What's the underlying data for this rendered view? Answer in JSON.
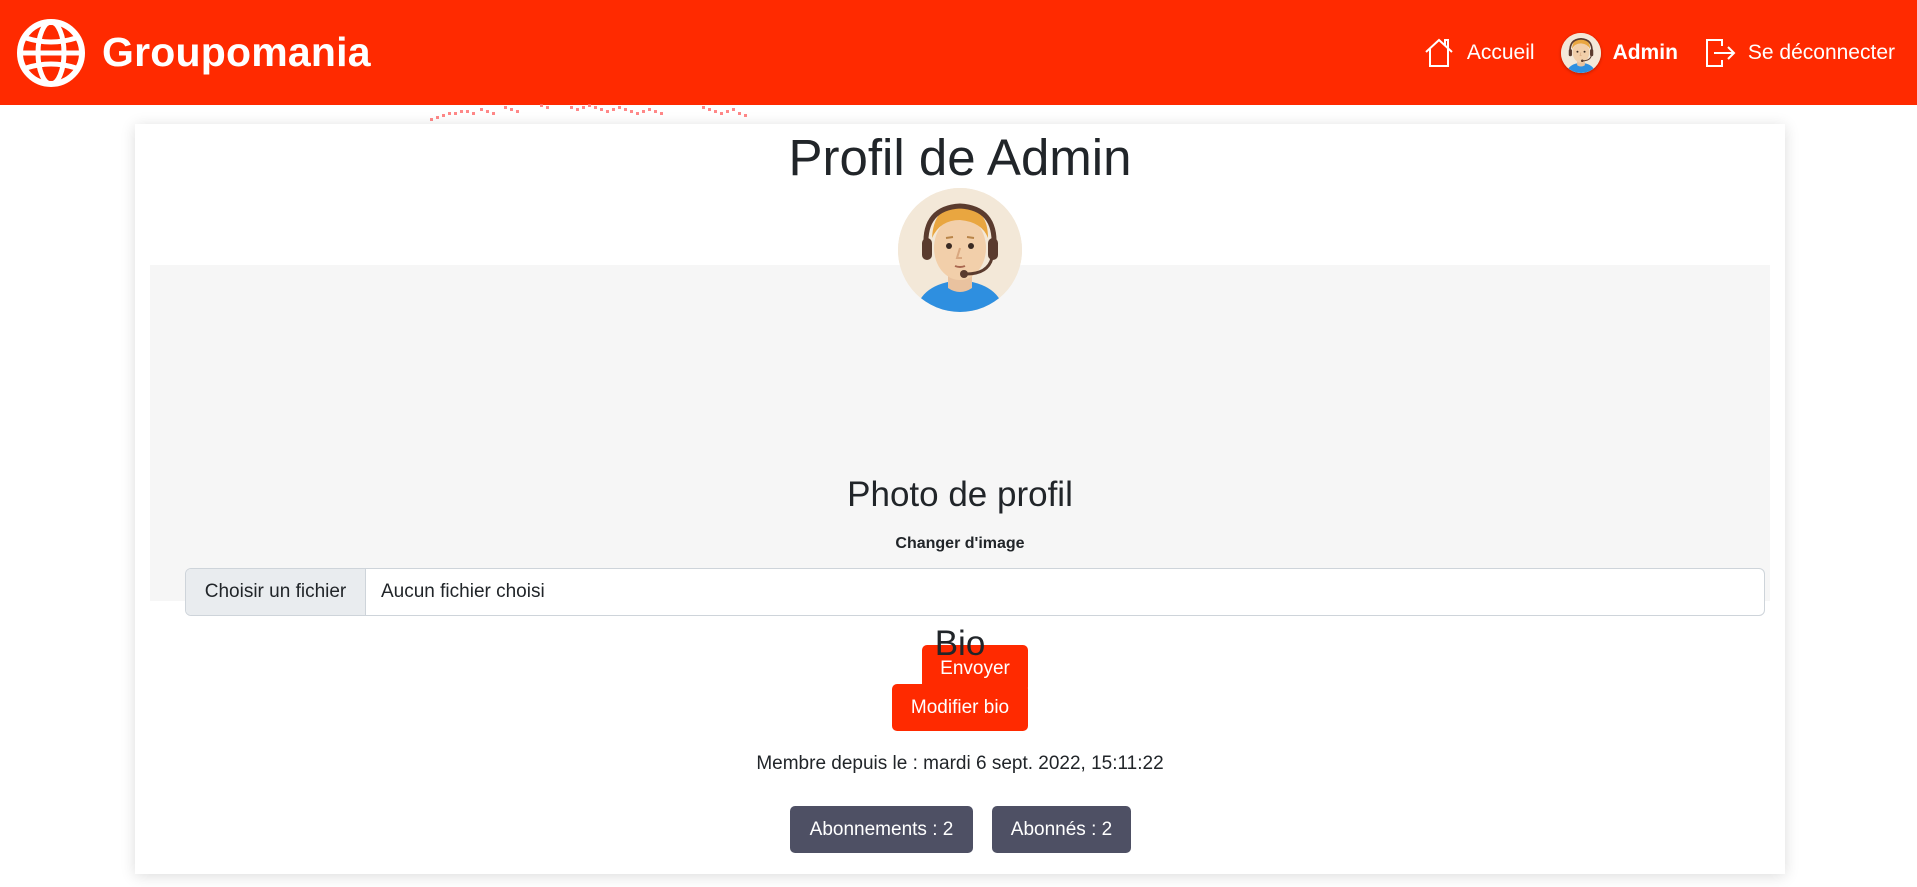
{
  "header": {
    "brand_name": "Groupomania",
    "nav": {
      "home_label": "Accueil",
      "user_label": "Admin",
      "logout_label": "Se déconnecter"
    }
  },
  "profile": {
    "title": "Profil de Admin",
    "photo_section": {
      "title": "Photo de profil",
      "change_label": "Changer d'image",
      "file_button_label": "Choisir un fichier",
      "file_status": "Aucun fichier choisi",
      "submit_label": "Envoyer"
    },
    "bio": {
      "title": "Bio",
      "edit_label": "Modifier bio"
    },
    "member_since": "Membre depuis le : mardi 6 sept. 2022, 15:11:22",
    "subscriptions_label": "Abonnements : 2",
    "followers_label": "Abonnés : 2"
  },
  "colors": {
    "accent": "#ff2a00",
    "secondary_button": "#4e5064",
    "section_background": "#f6f6f6"
  },
  "icons": [
    "globe-logo-icon",
    "home-icon",
    "logout-icon"
  ]
}
